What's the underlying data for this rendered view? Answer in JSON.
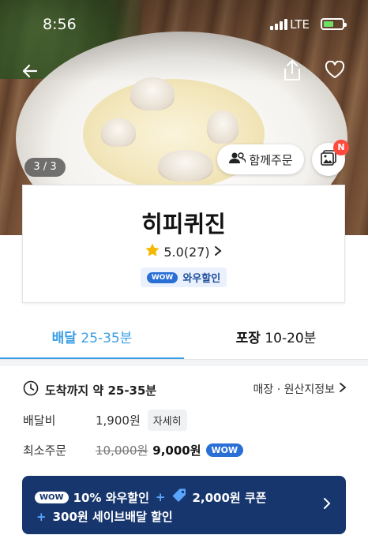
{
  "status_bar": {
    "time": "8:56",
    "network": "LTE"
  },
  "hero": {
    "image_counter": "3 / 3",
    "group_order_label": "함께주문",
    "gallery_badge": "N"
  },
  "store": {
    "name": "히피퀴진",
    "rating": "5.0(27)",
    "wow_tag": "WOW",
    "wow_label": "와우할인"
  },
  "tabs": {
    "delivery_label": "배달",
    "delivery_time": "25-35분",
    "pickup_label": "포장",
    "pickup_time": "10-20분"
  },
  "info": {
    "arrival_text": "도착까지 약 25-35분",
    "store_info_link": "매장 · 원산지정보",
    "delivery_fee_label": "배달비",
    "delivery_fee_value": "1,900원",
    "detail_button": "자세히",
    "min_order_label": "최소주문",
    "min_order_original": "10,000원",
    "min_order_value": "9,000원",
    "wow_tag": "WOW"
  },
  "promo_banner": {
    "wow_tag": "WOW",
    "discount": "10% 와우할인",
    "coupon": "2,000원 쿠폰",
    "save_delivery": "300원 세이브배달 할인"
  },
  "colors": {
    "accent_blue": "#3a9ee6",
    "wow_blue": "#2a6fd6",
    "banner_navy": "#17366e",
    "badge_red": "#ff4a3d",
    "star_yellow": "#f5b800"
  }
}
